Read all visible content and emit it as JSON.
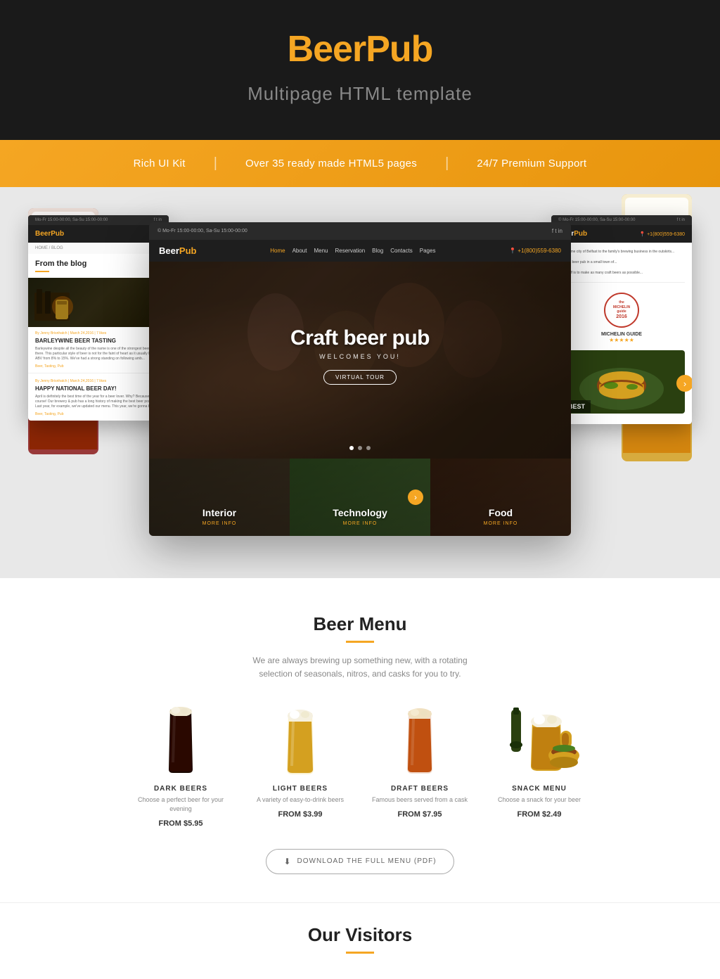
{
  "header": {
    "logo_text": "Beer",
    "logo_accent": "Pub",
    "subtitle": "Multipage HTML template"
  },
  "features": {
    "item1": "Rich UI Kit",
    "item2": "Over 35 ready made HTML5 pages",
    "item3": "24/7 Premium Support",
    "divider": "|"
  },
  "hero": {
    "title": "Craft beer pub",
    "welcome": "WELCOMES YOU!",
    "btn": "VIRTUAL TOUR"
  },
  "panels": {
    "interior": {
      "title": "Interior",
      "more": "More Info"
    },
    "technology": {
      "title": "Technology",
      "more": "More Info"
    },
    "food": {
      "title": "Food",
      "more": "More Info"
    }
  },
  "side_left": {
    "logo": "Beer",
    "logo_accent": "Pub",
    "nav_top": "Mo-Fr 15:00-00:00, Sa-Su 15:00-00:00",
    "breadcrumb": "HOME / BLOG",
    "heading": "From the blog",
    "blog1": {
      "meta": "By Jenny Brisnhatch | March 24,2016 | 7 likes",
      "title": "BARLEYWINE BEER TASTING",
      "desc": "Barleywine despite all the beauty of the name is one of the strongest beers out there. This particular style of beer is not for the faint of heart as it usually has an ABV from 8% to 15%. We've had a strong standing on following amb..."
    },
    "blog2": {
      "meta": "By Jenny Brisnhatch | March 24,2016 | 7 likes",
      "title": "HAPPY NATIONAL BEER DAY!",
      "desc": "April is definitely the best time of the year for a beer lover. Why? Because of course! Our brewery & pub has a long history of making the best beer possible. Last year, for example, we've updated our menu. This year, we're gonna beat it..."
    }
  },
  "side_right": {
    "logo": "Beer",
    "logo_accent": "Pub",
    "phone": "+1(800)559-6380",
    "michelin_guide": "the MICHELIN guide",
    "michelin_year": "2016",
    "michelin_title": "MICHELIN GUIDE",
    "stars": "★★★★★",
    "best_label": "BEST"
  },
  "beer_menu": {
    "title": "Beer Menu",
    "desc": "We are always brewing up something new, with a rotating selection of seasonals, nitros, and casks for you to try.",
    "beers": [
      {
        "name": "DARK BEERS",
        "desc": "Choose a perfect beer for your evening",
        "price": "FROM $5.95"
      },
      {
        "name": "LIGHT BEERS",
        "desc": "A variety of easy-to-drink beers",
        "price": "FROM $3.99"
      },
      {
        "name": "DRAFT BEERS",
        "desc": "Famous beers served from a cask",
        "price": "FROM $7.95"
      },
      {
        "name": "SNACK MENU",
        "desc": "Choose a snack for your beer",
        "price": "FROM $2.49"
      }
    ],
    "download_btn": "DOWNLOAD THE FULL MENU (PDF)"
  },
  "visitors": {
    "title": "Our Visitors"
  },
  "nav": {
    "home": "Home",
    "about": "About",
    "menu": "Menu",
    "reservation": "Reservation",
    "blog": "Blog",
    "contacts": "Contacts",
    "pages": "Pages",
    "phone": "+1(800)559-6380"
  }
}
